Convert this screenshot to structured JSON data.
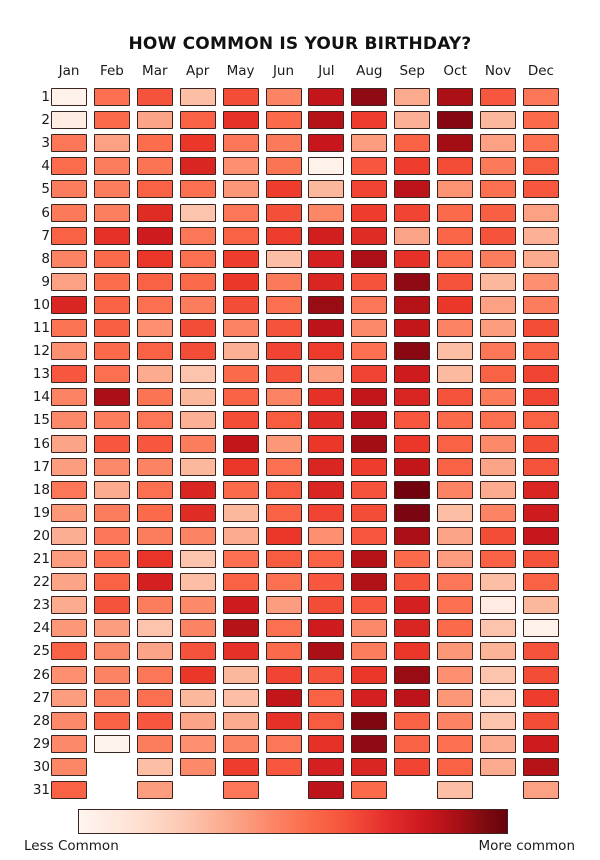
{
  "title": "HOW COMMON IS YOUR BIRTHDAY?",
  "colorbar": {
    "low_label": "Less Common",
    "high_label": "More common",
    "low_color": "#fff5f0",
    "high_color": "#67000d",
    "colormap": "Reds"
  },
  "chart_data": {
    "type": "heatmap",
    "title": "HOW COMMON IS YOUR BIRTHDAY?",
    "xlabel": "",
    "ylabel": "",
    "grid": false,
    "legend_position": "bottom",
    "colormap": "Reds",
    "value_range": [
      0,
      1
    ],
    "value_meaning": "Relative frequency of birthdays (0 = less common, 1 = more common)",
    "categories": [
      "Jan",
      "Feb",
      "Mar",
      "Apr",
      "May",
      "Jun",
      "Jul",
      "Aug",
      "Sep",
      "Oct",
      "Nov",
      "Dec"
    ],
    "days": [
      1,
      2,
      3,
      4,
      5,
      6,
      7,
      8,
      9,
      10,
      11,
      12,
      13,
      14,
      15,
      16,
      17,
      18,
      19,
      20,
      21,
      22,
      23,
      24,
      25,
      26,
      27,
      28,
      29,
      30,
      31
    ],
    "missing_cells": [
      {
        "day": 30,
        "month": "Feb"
      },
      {
        "day": 31,
        "month": "Feb"
      },
      {
        "day": 31,
        "month": "Apr"
      },
      {
        "day": 31,
        "month": "Jun"
      },
      {
        "day": 31,
        "month": "Sep"
      },
      {
        "day": 31,
        "month": "Nov"
      }
    ],
    "values": [
      [
        0.02,
        0.48,
        0.56,
        0.24,
        0.58,
        0.42,
        0.78,
        0.92,
        0.3,
        0.86,
        0.55,
        0.46
      ],
      [
        0.05,
        0.5,
        0.32,
        0.52,
        0.66,
        0.5,
        0.82,
        0.62,
        0.28,
        0.94,
        0.26,
        0.5
      ],
      [
        0.46,
        0.33,
        0.49,
        0.64,
        0.46,
        0.45,
        0.76,
        0.34,
        0.52,
        0.88,
        0.33,
        0.48
      ],
      [
        0.49,
        0.44,
        0.47,
        0.7,
        0.38,
        0.47,
        0.02,
        0.55,
        0.62,
        0.58,
        0.45,
        0.54
      ],
      [
        0.44,
        0.44,
        0.52,
        0.48,
        0.36,
        0.62,
        0.26,
        0.6,
        0.8,
        0.37,
        0.48,
        0.55
      ],
      [
        0.45,
        0.43,
        0.68,
        0.22,
        0.46,
        0.57,
        0.41,
        0.62,
        0.6,
        0.5,
        0.53,
        0.33
      ],
      [
        0.52,
        0.66,
        0.74,
        0.46,
        0.52,
        0.62,
        0.73,
        0.68,
        0.32,
        0.51,
        0.56,
        0.28
      ],
      [
        0.42,
        0.5,
        0.64,
        0.48,
        0.62,
        0.24,
        0.72,
        0.85,
        0.66,
        0.5,
        0.44,
        0.3
      ],
      [
        0.33,
        0.49,
        0.52,
        0.5,
        0.64,
        0.45,
        0.7,
        0.56,
        0.92,
        0.56,
        0.26,
        0.38
      ],
      [
        0.7,
        0.52,
        0.48,
        0.44,
        0.58,
        0.48,
        0.9,
        0.46,
        0.82,
        0.64,
        0.33,
        0.44
      ],
      [
        0.47,
        0.53,
        0.38,
        0.58,
        0.42,
        0.56,
        0.8,
        0.4,
        0.78,
        0.42,
        0.34,
        0.58
      ],
      [
        0.38,
        0.5,
        0.52,
        0.58,
        0.28,
        0.6,
        0.63,
        0.48,
        0.93,
        0.24,
        0.46,
        0.52
      ],
      [
        0.55,
        0.48,
        0.3,
        0.22,
        0.5,
        0.56,
        0.34,
        0.6,
        0.74,
        0.25,
        0.52,
        0.6
      ],
      [
        0.42,
        0.86,
        0.47,
        0.26,
        0.52,
        0.42,
        0.66,
        0.78,
        0.7,
        0.56,
        0.45,
        0.6
      ],
      [
        0.4,
        0.44,
        0.46,
        0.28,
        0.58,
        0.54,
        0.68,
        0.8,
        0.55,
        0.5,
        0.48,
        0.52
      ],
      [
        0.32,
        0.55,
        0.55,
        0.44,
        0.78,
        0.36,
        0.64,
        0.88,
        0.64,
        0.52,
        0.4,
        0.58
      ],
      [
        0.34,
        0.4,
        0.42,
        0.26,
        0.64,
        0.48,
        0.7,
        0.62,
        0.78,
        0.52,
        0.32,
        0.56
      ],
      [
        0.46,
        0.3,
        0.48,
        0.7,
        0.5,
        0.54,
        0.7,
        0.56,
        0.98,
        0.42,
        0.3,
        0.7
      ],
      [
        0.36,
        0.44,
        0.5,
        0.68,
        0.26,
        0.52,
        0.6,
        0.58,
        0.96,
        0.24,
        0.42,
        0.74
      ],
      [
        0.29,
        0.46,
        0.44,
        0.42,
        0.3,
        0.64,
        0.38,
        0.55,
        0.86,
        0.32,
        0.58,
        0.76
      ],
      [
        0.34,
        0.48,
        0.65,
        0.22,
        0.48,
        0.54,
        0.52,
        0.82,
        0.5,
        0.34,
        0.52,
        0.56
      ],
      [
        0.32,
        0.52,
        0.72,
        0.24,
        0.52,
        0.48,
        0.55,
        0.84,
        0.56,
        0.46,
        0.24,
        0.52
      ],
      [
        0.3,
        0.56,
        0.44,
        0.4,
        0.74,
        0.34,
        0.58,
        0.55,
        0.72,
        0.48,
        0.06,
        0.26
      ],
      [
        0.36,
        0.34,
        0.22,
        0.42,
        0.82,
        0.48,
        0.74,
        0.4,
        0.7,
        0.5,
        0.22,
        0.02
      ],
      [
        0.52,
        0.4,
        0.32,
        0.56,
        0.66,
        0.5,
        0.86,
        0.44,
        0.64,
        0.36,
        0.27,
        0.56
      ],
      [
        0.38,
        0.42,
        0.46,
        0.64,
        0.26,
        0.6,
        0.56,
        0.64,
        0.9,
        0.38,
        0.22,
        0.58
      ],
      [
        0.34,
        0.44,
        0.48,
        0.26,
        0.24,
        0.78,
        0.52,
        0.72,
        0.8,
        0.36,
        0.2,
        0.62
      ],
      [
        0.4,
        0.52,
        0.55,
        0.32,
        0.3,
        0.66,
        0.54,
        0.95,
        0.52,
        0.42,
        0.22,
        0.58
      ],
      [
        0.4,
        0.01,
        0.44,
        0.38,
        0.42,
        0.46,
        0.66,
        0.92,
        0.52,
        0.48,
        0.3,
        0.74
      ],
      [
        0.41,
        null,
        0.24,
        0.4,
        0.62,
        0.55,
        0.72,
        0.7,
        0.6,
        0.52,
        0.3,
        0.82
      ],
      [
        0.52,
        null,
        0.34,
        null,
        0.46,
        null,
        0.8,
        0.5,
        null,
        0.24,
        null,
        0.33
      ]
    ]
  }
}
